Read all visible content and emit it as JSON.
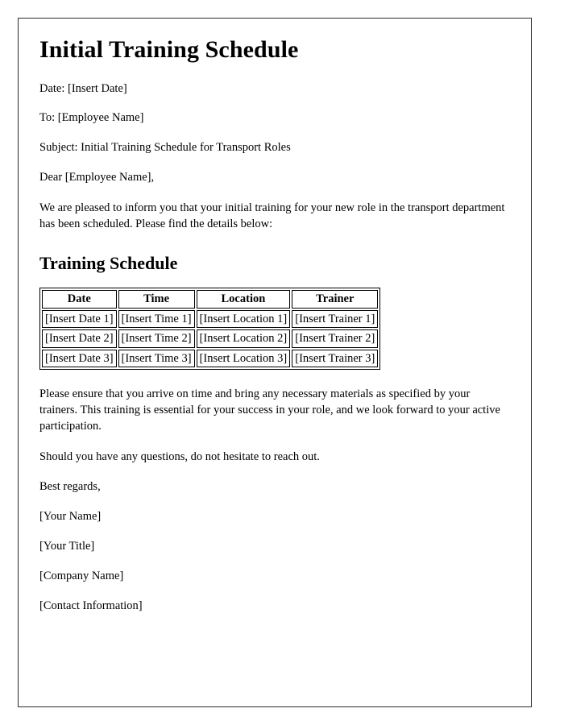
{
  "document": {
    "title": "Initial Training Schedule",
    "meta": [
      "Date: [Insert Date]",
      "To: [Employee Name]",
      "Subject: Initial Training Schedule for Transport Roles",
      "Dear [Employee Name],"
    ],
    "intro_paragraph": "We are pleased to inform you that your initial training for your new role in the transport department has been scheduled. Please find the details below:",
    "schedule_heading": "Training Schedule",
    "table": {
      "headers": [
        "Date",
        "Time",
        "Location",
        "Trainer"
      ],
      "rows": [
        [
          "[Insert Date 1]",
          "[Insert Time 1]",
          "[Insert Location 1]",
          "[Insert Trainer 1]"
        ],
        [
          "[Insert Date 2]",
          "[Insert Time 2]",
          "[Insert Location 2]",
          "[Insert Trainer 2]"
        ],
        [
          "[Insert Date 3]",
          "[Insert Time 3]",
          "[Insert Location 3]",
          "[Insert Trainer 3]"
        ]
      ]
    },
    "body_paragraphs": [
      "Please ensure that you arrive on time and bring any necessary materials as specified by your trainers. This training is essential for your success in your role, and we look forward to your active participation.",
      "Should you have any questions, do not hesitate to reach out."
    ],
    "closing": "Best regards,",
    "signature": [
      "[Your Name]",
      "[Your Title]",
      "[Company Name]",
      "[Contact Information]"
    ],
    "colors": {
      "text": "#000000",
      "page_border": "#2b2b2b",
      "table_border": "#000000",
      "background": "#ffffff"
    }
  }
}
